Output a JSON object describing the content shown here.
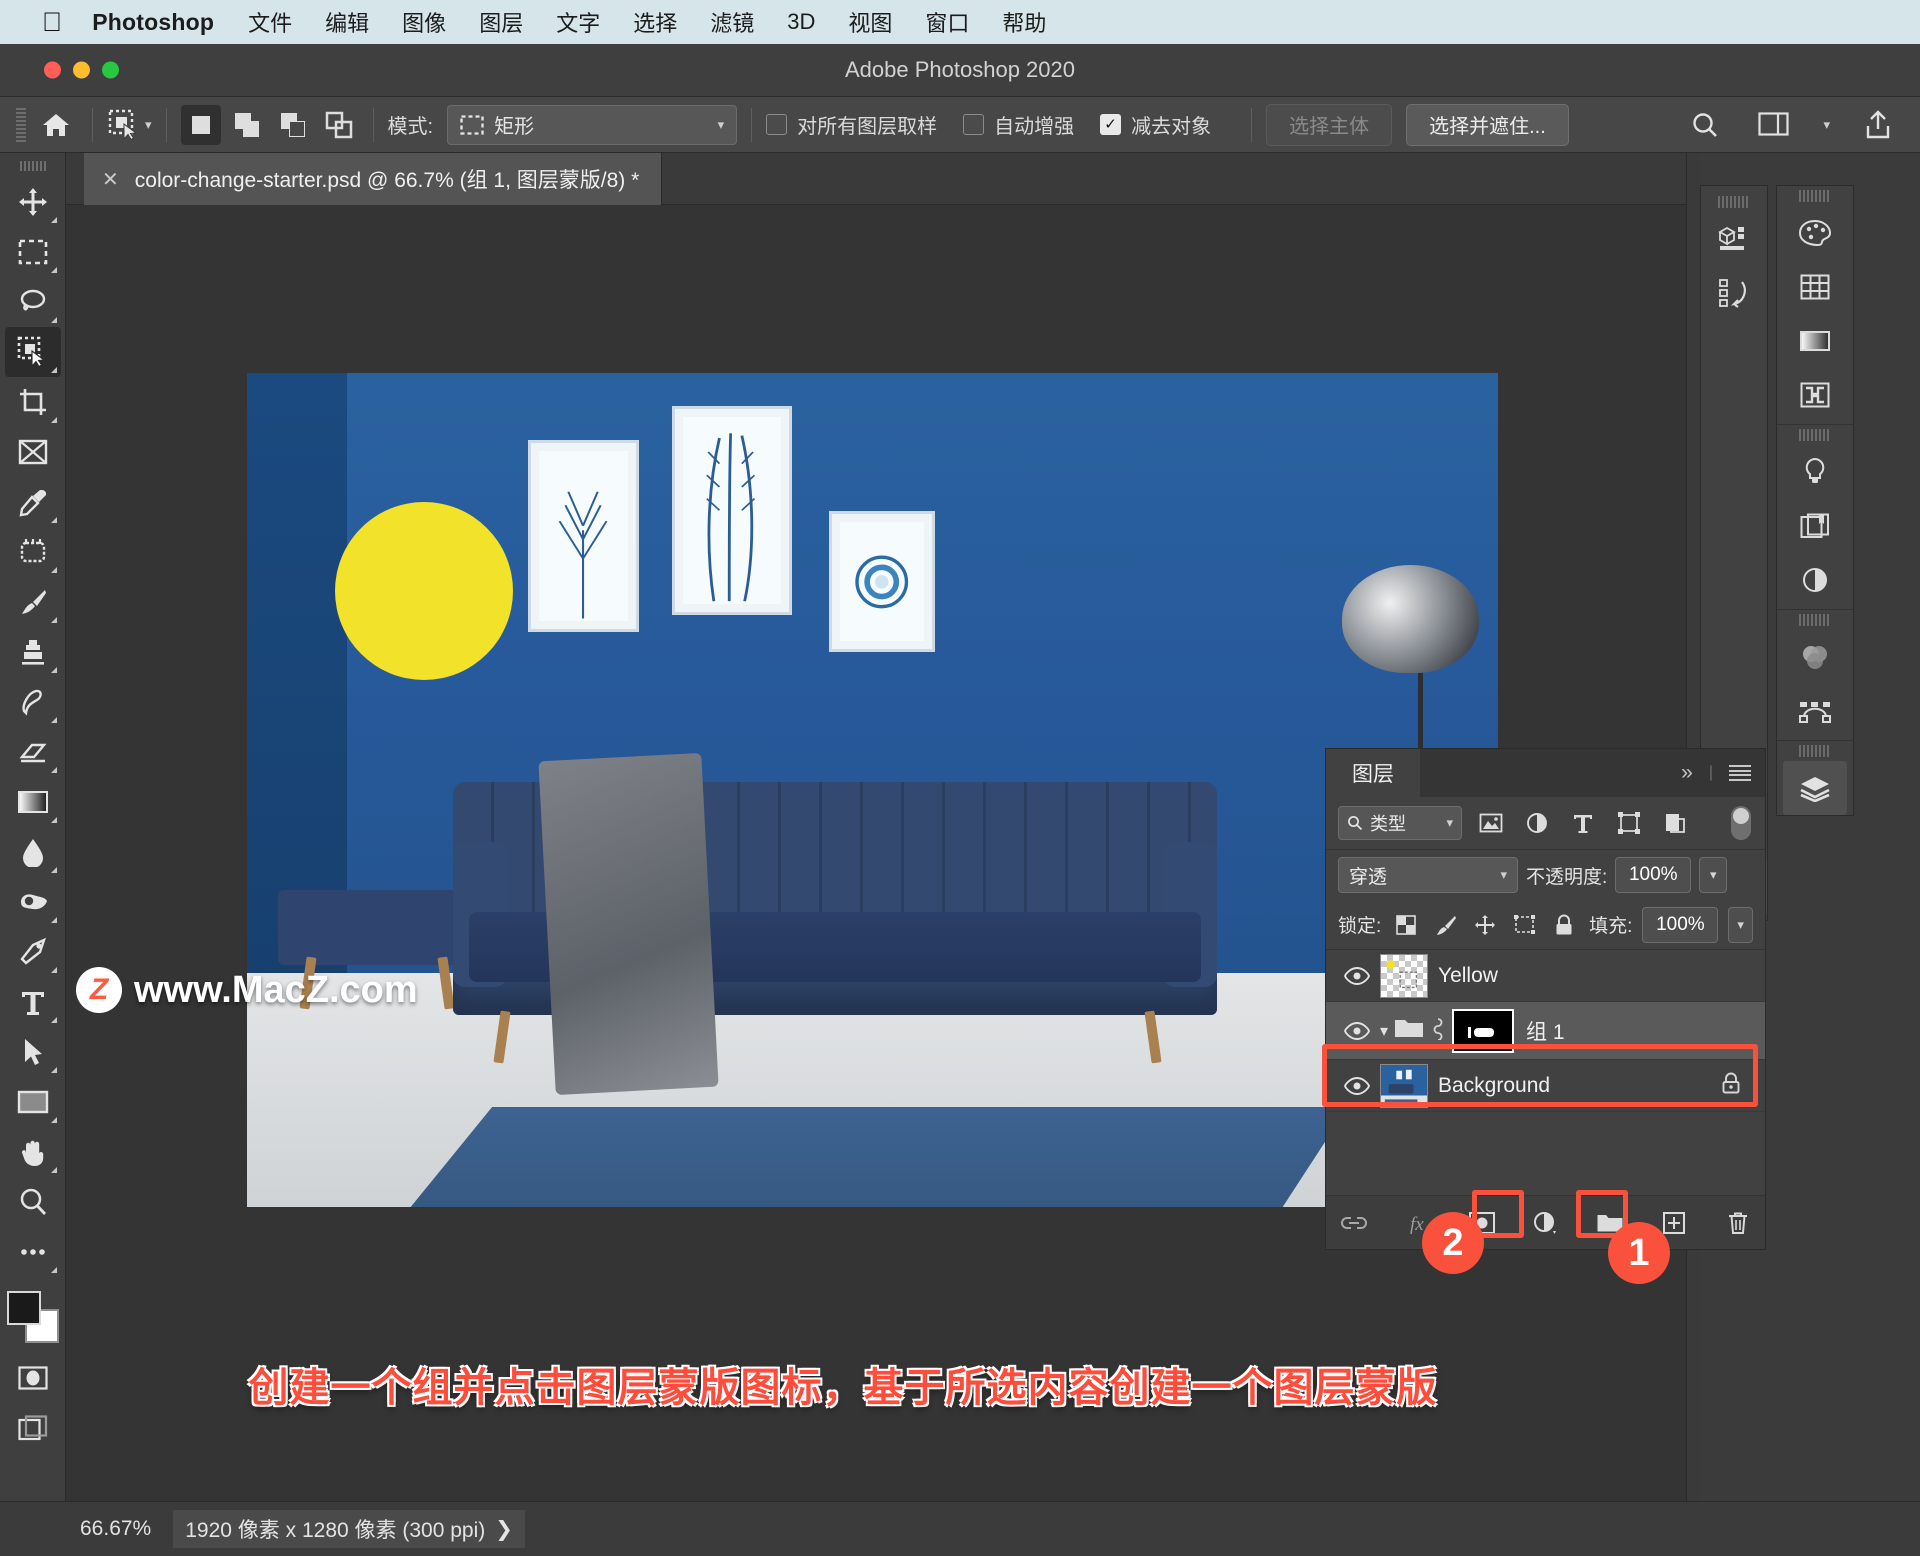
{
  "menubar": {
    "apple_icon": "apple-icon",
    "app_name": "Photoshop",
    "items": [
      "文件",
      "编辑",
      "图像",
      "图层",
      "文字",
      "选择",
      "滤镜",
      "3D",
      "视图",
      "窗口",
      "帮助"
    ]
  },
  "titlebar": {
    "title": "Adobe Photoshop 2020"
  },
  "options_bar": {
    "home_icon": "home-icon",
    "tool_preset_icon": "quick-selection-tool-icon",
    "selection_modes": [
      "new-selection",
      "add-to-selection",
      "subtract-from-selection",
      "intersect-selection"
    ],
    "mode_label": "模式:",
    "mode_value": "矩形",
    "checkboxes": [
      {
        "label": "对所有图层取样",
        "checked": false
      },
      {
        "label": "自动增强",
        "checked": false
      },
      {
        "label": "减去对象",
        "checked": true
      }
    ],
    "select_subject": "选择主体",
    "select_and_mask": "选择并遮住...",
    "search_icon": "search-icon",
    "workspace_icon": "workspace-icon",
    "share_icon": "share-icon"
  },
  "toolbar": {
    "tools_top": [
      "move-tool",
      "rectangular-marquee-tool",
      "lasso-tool",
      "quick-selection-tool",
      "crop-tool",
      "frame-tool",
      "eyedropper-tool",
      "spot-healing-brush-tool",
      "brush-tool",
      "clone-stamp-tool",
      "history-brush-tool",
      "eraser-tool",
      "gradient-tool",
      "blur-tool",
      "dodge-tool",
      "pen-tool",
      "horizontal-type-tool",
      "path-selection-tool",
      "rectangle-tool",
      "hand-tool",
      "zoom-tool",
      "edit-toolbar-tool"
    ],
    "selected_tool": "quick-selection-tool",
    "foreground_color": "#1a1a1a",
    "background_color": "#ffffff",
    "quick-mask-icon": "quick-mask-icon",
    "screen-mode-icon": "screen-mode-icon"
  },
  "document_tab": {
    "close_icon": "close-icon",
    "title": "color-change-starter.psd @ 66.7% (组 1, 图层蒙版/8) *"
  },
  "canvas": {
    "watermark_logo": "Z",
    "watermark_text": "www.MacZ.com",
    "caption": "创建一个组并点击图层蒙版图标，基于所选内容创建一个图层蒙版"
  },
  "layers_panel": {
    "tab_label": "图层",
    "expand_icon": "chevron-double-right-icon",
    "menu_icon": "panel-menu-icon",
    "filter": {
      "search_icon": "search-icon",
      "kind_label": "类型",
      "chevron_icon": "chevron-down-icon",
      "filter_icons": [
        "pixel-layers-filter-icon",
        "adjustment-layers-filter-icon",
        "type-layers-filter-icon",
        "shape-layers-filter-icon",
        "smart-object-filter-icon"
      ],
      "toggle_icon": "filter-toggle-icon"
    },
    "blend_mode": "穿透",
    "opacity_label": "不透明度:",
    "opacity_value": "100%",
    "lock_label": "锁定:",
    "lock_icons": [
      "lock-transparent-pixels-icon",
      "lock-image-pixels-icon",
      "lock-position-icon",
      "lock-artboard-nesting-icon",
      "lock-all-icon"
    ],
    "fill_label": "填充:",
    "fill_value": "100%",
    "layers": [
      {
        "name": "Yellow",
        "visible": true,
        "type": "pixel",
        "selected": false,
        "locked": false
      },
      {
        "name": "组 1",
        "visible": true,
        "type": "group",
        "selected": true,
        "locked": false,
        "has_mask": true,
        "link_icon": "link-mask-icon",
        "expand_icon": "chevron-down-icon",
        "folder_icon": "folder-icon"
      },
      {
        "name": "Background",
        "visible": true,
        "type": "image",
        "selected": false,
        "locked": true,
        "lock_icon": "lock-icon"
      }
    ],
    "bottom_buttons": [
      {
        "name": "link-layers-icon"
      },
      {
        "name": "layer-style-fx-icon"
      },
      {
        "name": "add-layer-mask-icon"
      },
      {
        "name": "new-adjustment-layer-icon"
      },
      {
        "name": "new-group-icon"
      },
      {
        "name": "new-layer-icon"
      },
      {
        "name": "delete-layer-icon"
      }
    ],
    "annotations": [
      {
        "number": "2",
        "target": "add-layer-mask-icon"
      },
      {
        "number": "1",
        "target": "new-group-icon"
      }
    ],
    "highlight_color": "#fa513c"
  },
  "right_dock": {
    "group_a": [
      "3d-panel-icon",
      "history-panel-icon"
    ],
    "group_b": [
      "color-panel-icon",
      "swatches-panel-icon",
      "gradients-panel-icon",
      "patterns-panel-icon"
    ],
    "group_c": [
      "adjustments-panel-icon",
      "libraries-panel-icon",
      "properties-panel-icon"
    ],
    "group_d": [
      "channels-panel-icon",
      "paths-panel-icon"
    ],
    "group_e": [
      "layers-panel-icon"
    ],
    "active_panel": "layers-panel-icon"
  },
  "status_bar": {
    "zoom": "66.67%",
    "doc_size": "1920 像素 x 1280 像素 (300 ppi)",
    "chevron_icon": "chevron-right-icon"
  }
}
